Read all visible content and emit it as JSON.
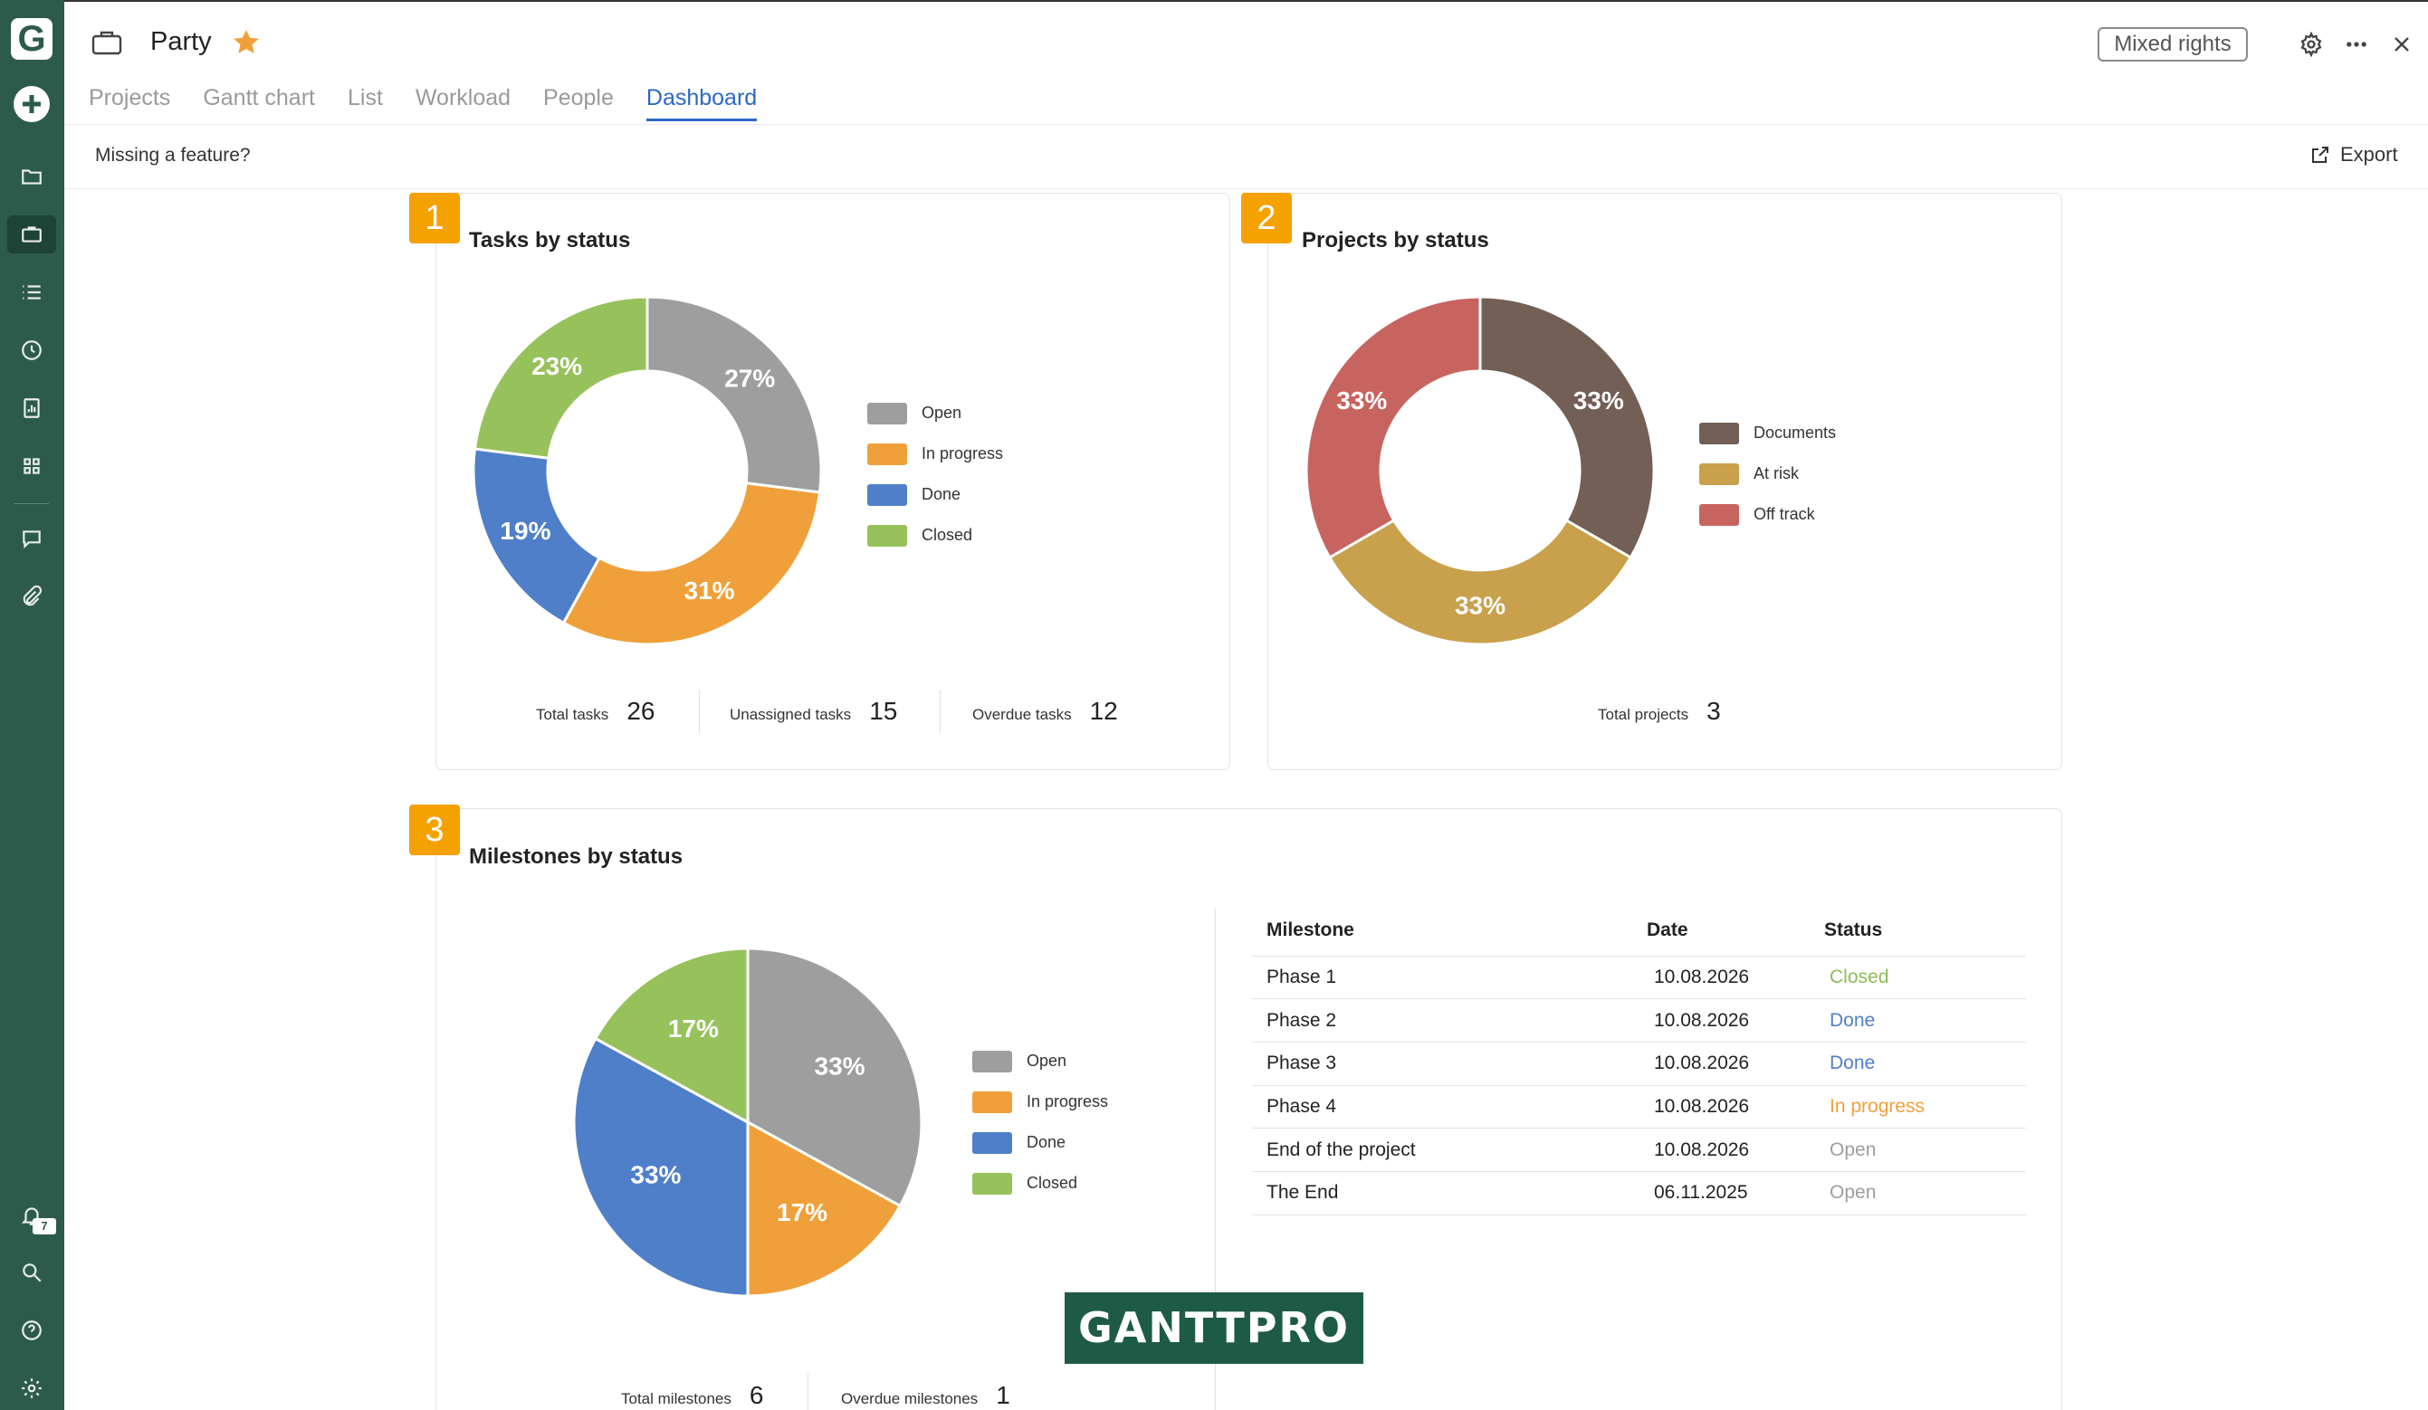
{
  "app": {
    "logo_letter": "G",
    "notification_count": "7"
  },
  "header": {
    "project_name": "Party",
    "tabs": [
      {
        "label": "Projects"
      },
      {
        "label": "Gantt chart"
      },
      {
        "label": "List"
      },
      {
        "label": "Workload"
      },
      {
        "label": "People"
      },
      {
        "label": "Dashboard"
      }
    ],
    "active_tab": "Dashboard",
    "rights_label": "Mixed rights"
  },
  "subbar": {
    "missing_feature": "Missing a feature?",
    "export_label": "Export"
  },
  "cards": {
    "tasks": {
      "badge": "1",
      "title": "Tasks by status",
      "stats": {
        "total_label": "Total tasks",
        "total_value": "26",
        "unassigned_label": "Unassigned tasks",
        "unassigned_value": "15",
        "overdue_label": "Overdue tasks",
        "overdue_value": "12"
      }
    },
    "projects": {
      "badge": "2",
      "title": "Projects by status",
      "stats": {
        "total_label": "Total projects",
        "total_value": "3"
      }
    },
    "milestones": {
      "badge": "3",
      "title": "Milestones by status",
      "stats": {
        "total_label": "Total milestones",
        "total_value": "6",
        "overdue_label": "Overdue milestones",
        "overdue_value": "1"
      },
      "table": {
        "headers": {
          "milestone": "Milestone",
          "date": "Date",
          "status": "Status"
        },
        "rows": [
          {
            "milestone": "Phase 1",
            "date": "10.08.2026",
            "status": "Closed"
          },
          {
            "milestone": "Phase 2",
            "date": "10.08.2026",
            "status": "Done"
          },
          {
            "milestone": "Phase 3",
            "date": "10.08.2026",
            "status": "Done"
          },
          {
            "milestone": "Phase 4",
            "date": "10.08.2026",
            "status": "In progress"
          },
          {
            "milestone": "End of the project",
            "date": "10.08.2026",
            "status": "Open"
          },
          {
            "milestone": "The End",
            "date": "06.11.2025",
            "status": "Open"
          }
        ]
      }
    }
  },
  "watermark": "GANTTPRO",
  "colors": {
    "sidebar": "#2d5b4b",
    "accent": "#2c68c5",
    "badge": "#f5a100",
    "open": "#9e9e9e",
    "in_progress": "#f0a03a",
    "done": "#4f7fc9",
    "closed": "#97c15b",
    "documents": "#735f55",
    "at_risk": "#c9a04b",
    "off_track": "#c8645f"
  },
  "chart_data": [
    {
      "type": "pie",
      "variant": "donut",
      "title": "Tasks by status",
      "categories": [
        "Open",
        "In progress",
        "Done",
        "Closed"
      ],
      "values": [
        27,
        31,
        19,
        23
      ],
      "value_labels": [
        "27%",
        "31%",
        "19%",
        "23%"
      ],
      "colors": [
        "#9e9e9e",
        "#f0a03a",
        "#4f7fc9",
        "#97c15b"
      ],
      "legend": "right"
    },
    {
      "type": "pie",
      "variant": "donut",
      "title": "Projects by status",
      "categories": [
        "Documents",
        "At risk",
        "Off track"
      ],
      "values": [
        33,
        33,
        33
      ],
      "value_labels": [
        "33%",
        "33%",
        "33%"
      ],
      "colors": [
        "#735f55",
        "#c9a04b",
        "#c8645f"
      ],
      "legend": "right"
    },
    {
      "type": "pie",
      "title": "Milestones by status",
      "categories": [
        "Open",
        "In progress",
        "Done",
        "Closed"
      ],
      "values": [
        33,
        17,
        33,
        17
      ],
      "value_labels": [
        "33%",
        "17%",
        "33%",
        "17%"
      ],
      "colors": [
        "#9e9e9e",
        "#f0a03a",
        "#4f7fc9",
        "#97c15b"
      ],
      "legend": "right"
    }
  ]
}
